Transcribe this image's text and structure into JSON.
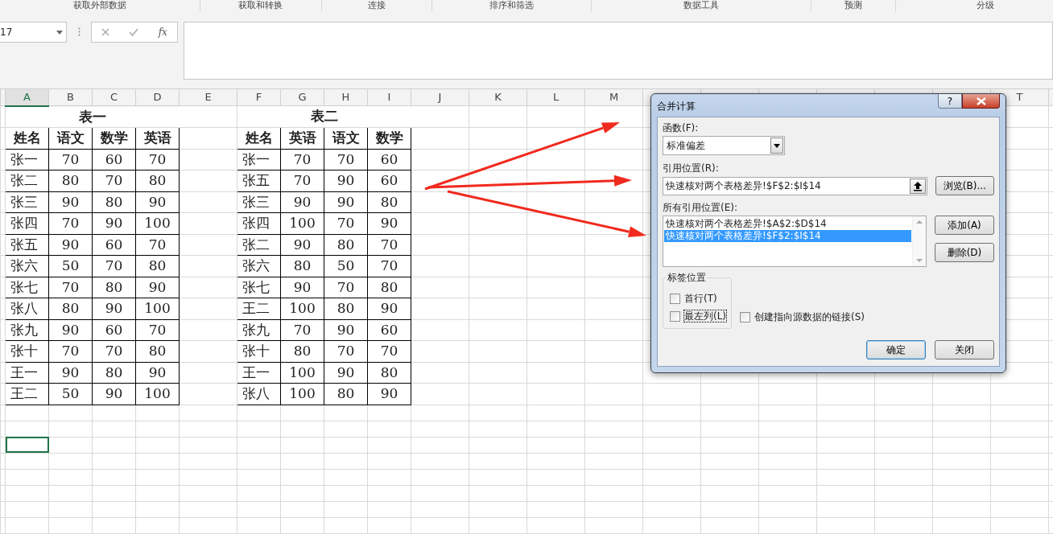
{
  "ribbon_groups": [
    "获取外部数据",
    "获取和转换",
    "连接",
    "排序和筛选",
    "数据工具",
    "预测",
    "分级"
  ],
  "name_box": {
    "value": "17"
  },
  "function_button": "fx",
  "columns": [
    {
      "label": "A",
      "selected": true
    },
    {
      "label": "B",
      "selected": false
    },
    {
      "label": "C",
      "selected": false
    },
    {
      "label": "D",
      "selected": false
    },
    {
      "label": "E",
      "selected": false
    },
    {
      "label": "F",
      "selected": false
    },
    {
      "label": "G",
      "selected": false
    },
    {
      "label": "H",
      "selected": false
    },
    {
      "label": "I",
      "selected": false
    },
    {
      "label": "J",
      "selected": false
    },
    {
      "label": "K",
      "selected": false
    },
    {
      "label": "L",
      "selected": false
    },
    {
      "label": "M",
      "selected": false
    },
    {
      "label": "T",
      "selected": false
    }
  ],
  "tables": [
    {
      "title": "表一",
      "headers": [
        "姓名",
        "语文",
        "数学",
        "英语"
      ],
      "rows": [
        [
          "张一",
          "70",
          "60",
          "70"
        ],
        [
          "张二",
          "80",
          "70",
          "80"
        ],
        [
          "张三",
          "90",
          "80",
          "90"
        ],
        [
          "张四",
          "70",
          "90",
          "100"
        ],
        [
          "张五",
          "90",
          "60",
          "70"
        ],
        [
          "张六",
          "50",
          "70",
          "80"
        ],
        [
          "张七",
          "70",
          "80",
          "90"
        ],
        [
          "张八",
          "80",
          "90",
          "100"
        ],
        [
          "张九",
          "90",
          "60",
          "70"
        ],
        [
          "张十",
          "70",
          "70",
          "80"
        ],
        [
          "王一",
          "90",
          "80",
          "90"
        ],
        [
          "王二",
          "50",
          "90",
          "100"
        ]
      ]
    },
    {
      "title": "表二",
      "headers": [
        "姓名",
        "英语",
        "语文",
        "数学"
      ],
      "rows": [
        [
          "张一",
          "70",
          "70",
          "60"
        ],
        [
          "张五",
          "70",
          "90",
          "60"
        ],
        [
          "张三",
          "90",
          "90",
          "80"
        ],
        [
          "张四",
          "100",
          "70",
          "90"
        ],
        [
          "张二",
          "90",
          "80",
          "70"
        ],
        [
          "张六",
          "80",
          "50",
          "70"
        ],
        [
          "张七",
          "90",
          "70",
          "80"
        ],
        [
          "王二",
          "100",
          "80",
          "90"
        ],
        [
          "张九",
          "70",
          "90",
          "60"
        ],
        [
          "张十",
          "80",
          "70",
          "70"
        ],
        [
          "王一",
          "100",
          "90",
          "80"
        ],
        [
          "张八",
          "100",
          "80",
          "90"
        ]
      ]
    }
  ],
  "dialog": {
    "title": "合并计算",
    "help": "?",
    "function_label": "函数(F):",
    "function_value": "标准偏差",
    "reference_label": "引用位置(R):",
    "reference_value": "快速核对两个表格差异!$F$2:$I$14",
    "browse_button": "浏览(B)...",
    "all_references_label": "所有引用位置(E):",
    "all_references": [
      {
        "text": "快速核对两个表格差异!$A$2:$D$14",
        "selected": false
      },
      {
        "text": "快速核对两个表格差异!$F$2:$I$14",
        "selected": true
      }
    ],
    "add_button": "添加(A)",
    "delete_button": "删除(D)",
    "label_group": "标签位置",
    "label_options": [
      {
        "label": "首行(T)",
        "checked": false,
        "focused": false
      },
      {
        "label": "最左列(L)",
        "checked": false,
        "focused": true
      }
    ],
    "link_option": {
      "label": "创建指向源数据的链接(S)",
      "checked": false
    },
    "ok_button": "确定",
    "close_button": "关闭"
  }
}
